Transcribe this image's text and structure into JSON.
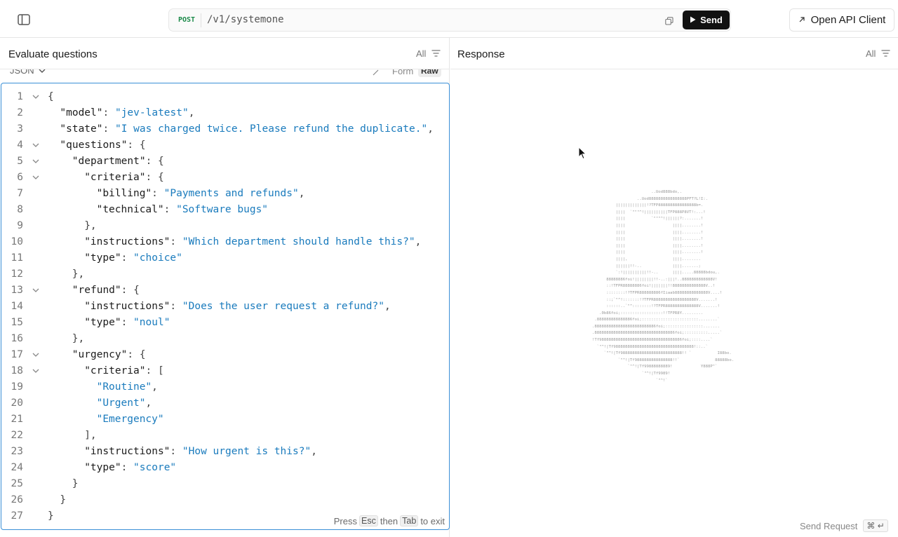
{
  "topbar": {
    "method": "POST",
    "path": "/v1/systemone",
    "send_label": "Send",
    "open_client_label": "Open API Client"
  },
  "left_panel": {
    "title": "Evaluate questions",
    "filter_label": "All",
    "body_format": "JSON",
    "mode_form": "Form",
    "mode_raw": "Raw",
    "exit_hint": {
      "press": "Press",
      "esc": "Esc",
      "then": "then",
      "tab": "Tab",
      "to_exit": "to exit"
    }
  },
  "right_panel": {
    "title": "Response",
    "filter_label": "All",
    "send_request_label": "Send Request",
    "send_request_shortcut": "⌘ ↵"
  },
  "code_lines": [
    {
      "n": "1",
      "fold": true,
      "indent": 0,
      "parts": [
        {
          "t": "{",
          "c": "p"
        }
      ]
    },
    {
      "n": "2",
      "fold": false,
      "indent": 1,
      "parts": [
        {
          "t": "\"model\"",
          "c": "k"
        },
        {
          "t": ": ",
          "c": "p"
        },
        {
          "t": "\"jev-latest\"",
          "c": "s"
        },
        {
          "t": ",",
          "c": "p"
        }
      ]
    },
    {
      "n": "3",
      "fold": false,
      "indent": 1,
      "parts": [
        {
          "t": "\"state\"",
          "c": "k"
        },
        {
          "t": ": ",
          "c": "p"
        },
        {
          "t": "\"I was charged twice. Please refund the duplicate.\"",
          "c": "s"
        },
        {
          "t": ",",
          "c": "p"
        }
      ]
    },
    {
      "n": "4",
      "fold": true,
      "indent": 1,
      "parts": [
        {
          "t": "\"questions\"",
          "c": "k"
        },
        {
          "t": ": {",
          "c": "p"
        }
      ]
    },
    {
      "n": "5",
      "fold": true,
      "indent": 2,
      "parts": [
        {
          "t": "\"department\"",
          "c": "k"
        },
        {
          "t": ": {",
          "c": "p"
        }
      ]
    },
    {
      "n": "6",
      "fold": true,
      "indent": 3,
      "parts": [
        {
          "t": "\"criteria\"",
          "c": "k"
        },
        {
          "t": ": {",
          "c": "p"
        }
      ]
    },
    {
      "n": "7",
      "fold": false,
      "indent": 4,
      "parts": [
        {
          "t": "\"billing\"",
          "c": "k"
        },
        {
          "t": ": ",
          "c": "p"
        },
        {
          "t": "\"Payments and refunds\"",
          "c": "s"
        },
        {
          "t": ",",
          "c": "p"
        }
      ]
    },
    {
      "n": "8",
      "fold": false,
      "indent": 4,
      "parts": [
        {
          "t": "\"technical\"",
          "c": "k"
        },
        {
          "t": ": ",
          "c": "p"
        },
        {
          "t": "\"Software bugs\"",
          "c": "s"
        }
      ]
    },
    {
      "n": "9",
      "fold": false,
      "indent": 3,
      "parts": [
        {
          "t": "},",
          "c": "p"
        }
      ]
    },
    {
      "n": "10",
      "fold": false,
      "indent": 3,
      "parts": [
        {
          "t": "\"instructions\"",
          "c": "k"
        },
        {
          "t": ": ",
          "c": "p"
        },
        {
          "t": "\"Which department should handle this?\"",
          "c": "s"
        },
        {
          "t": ",",
          "c": "p"
        }
      ]
    },
    {
      "n": "11",
      "fold": false,
      "indent": 3,
      "parts": [
        {
          "t": "\"type\"",
          "c": "k"
        },
        {
          "t": ": ",
          "c": "p"
        },
        {
          "t": "\"choice\"",
          "c": "s"
        }
      ]
    },
    {
      "n": "12",
      "fold": false,
      "indent": 2,
      "parts": [
        {
          "t": "},",
          "c": "p"
        }
      ]
    },
    {
      "n": "13",
      "fold": true,
      "indent": 2,
      "parts": [
        {
          "t": "\"refund\"",
          "c": "k"
        },
        {
          "t": ": {",
          "c": "p"
        }
      ]
    },
    {
      "n": "14",
      "fold": false,
      "indent": 3,
      "parts": [
        {
          "t": "\"instructions\"",
          "c": "k"
        },
        {
          "t": ": ",
          "c": "p"
        },
        {
          "t": "\"Does the user request a refund?\"",
          "c": "s"
        },
        {
          "t": ",",
          "c": "p"
        }
      ]
    },
    {
      "n": "15",
      "fold": false,
      "indent": 3,
      "parts": [
        {
          "t": "\"type\"",
          "c": "k"
        },
        {
          "t": ": ",
          "c": "p"
        },
        {
          "t": "\"noul\"",
          "c": "s"
        }
      ]
    },
    {
      "n": "16",
      "fold": false,
      "indent": 2,
      "parts": [
        {
          "t": "},",
          "c": "p"
        }
      ]
    },
    {
      "n": "17",
      "fold": true,
      "indent": 2,
      "parts": [
        {
          "t": "\"urgency\"",
          "c": "k"
        },
        {
          "t": ": {",
          "c": "p"
        }
      ]
    },
    {
      "n": "18",
      "fold": true,
      "indent": 3,
      "parts": [
        {
          "t": "\"criteria\"",
          "c": "k"
        },
        {
          "t": ": [",
          "c": "p"
        }
      ]
    },
    {
      "n": "19",
      "fold": false,
      "indent": 4,
      "parts": [
        {
          "t": "\"Routine\"",
          "c": "s"
        },
        {
          "t": ",",
          "c": "p"
        }
      ]
    },
    {
      "n": "20",
      "fold": false,
      "indent": 4,
      "parts": [
        {
          "t": "\"Urgent\"",
          "c": "s"
        },
        {
          "t": ",",
          "c": "p"
        }
      ]
    },
    {
      "n": "21",
      "fold": false,
      "indent": 4,
      "parts": [
        {
          "t": "\"Emergency\"",
          "c": "s"
        }
      ]
    },
    {
      "n": "22",
      "fold": false,
      "indent": 3,
      "parts": [
        {
          "t": "],",
          "c": "p"
        }
      ]
    },
    {
      "n": "23",
      "fold": false,
      "indent": 3,
      "parts": [
        {
          "t": "\"instructions\"",
          "c": "k"
        },
        {
          "t": ": ",
          "c": "p"
        },
        {
          "t": "\"How urgent is this?\"",
          "c": "s"
        },
        {
          "t": ",",
          "c": "p"
        }
      ]
    },
    {
      "n": "24",
      "fold": false,
      "indent": 3,
      "parts": [
        {
          "t": "\"type\"",
          "c": "k"
        },
        {
          "t": ": ",
          "c": "p"
        },
        {
          "t": "\"score\"",
          "c": "s"
        }
      ]
    },
    {
      "n": "25",
      "fold": false,
      "indent": 2,
      "parts": [
        {
          "t": "}",
          "c": "p"
        }
      ]
    },
    {
      "n": "26",
      "fold": false,
      "indent": 1,
      "parts": [
        {
          "t": "}",
          "c": "p"
        }
      ]
    },
    {
      "n": "27",
      "fold": false,
      "indent": 0,
      "parts": [
        {
          "t": "}",
          "c": "p"
        }
      ]
    }
  ],
  "icons": {
    "sidebar_toggle": "sidebar-toggle-icon",
    "copy": "copy-icon",
    "play": "play-icon",
    "external_arrow": "arrow-up-right-icon",
    "filter": "filter-lines-icon",
    "chevron": "chevron-down-icon",
    "wand": "magic-wand-icon",
    "cursor": "mouse-pointer-icon"
  },
  "colors": {
    "accent_border": "#3a8fd6",
    "string": "#1a7bbd",
    "method": "#1c8a4a",
    "send_button": "#111111"
  }
}
